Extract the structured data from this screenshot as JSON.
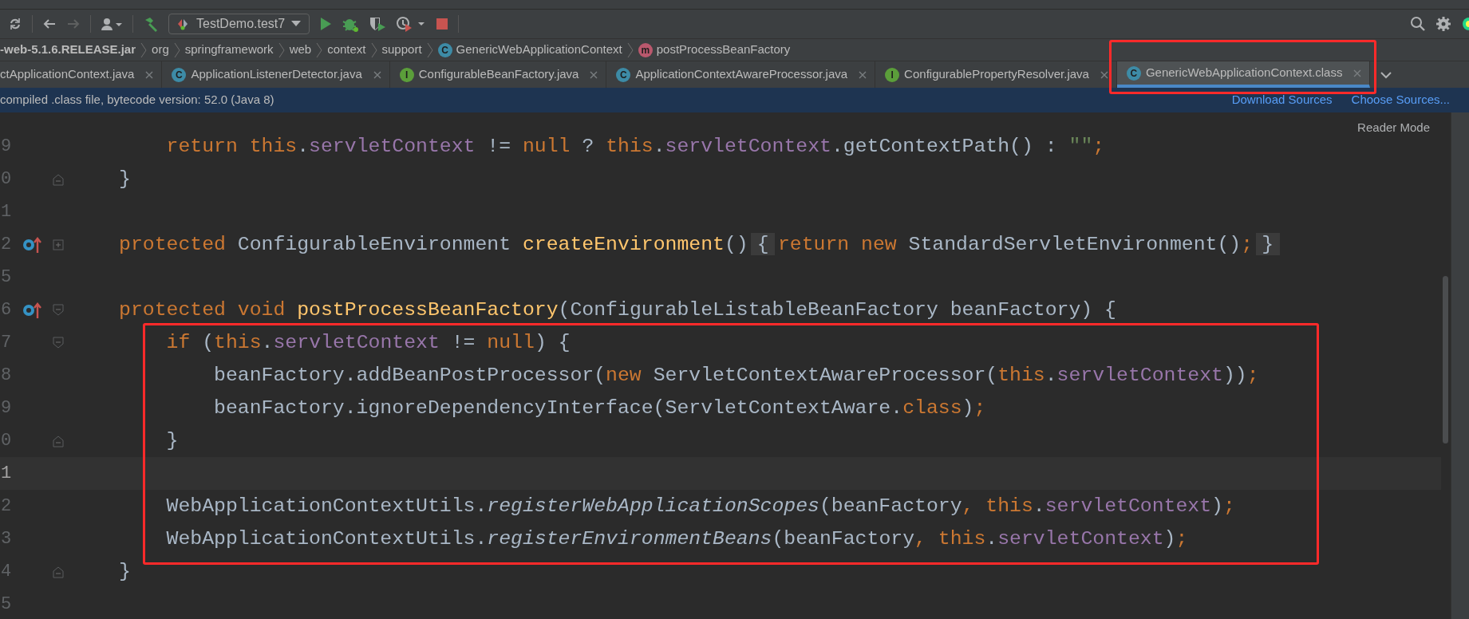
{
  "toolbar": {
    "run_config": "TestDemo.test7"
  },
  "breadcrumbs": [
    {
      "label": "-web-5.1.6.RELEASE.jar",
      "kind": "jar"
    },
    {
      "label": "org",
      "kind": "package"
    },
    {
      "label": "springframework",
      "kind": "package"
    },
    {
      "label": "web",
      "kind": "package"
    },
    {
      "label": "context",
      "kind": "package"
    },
    {
      "label": "support",
      "kind": "package"
    },
    {
      "label": "GenericWebApplicationContext",
      "kind": "class",
      "badge": "C"
    },
    {
      "label": "postProcessBeanFactory",
      "kind": "method",
      "badge": "m"
    }
  ],
  "tabs": [
    {
      "label": "ctApplicationContext.java",
      "kind": "plain",
      "selected": false,
      "highlighted": false
    },
    {
      "label": "ApplicationListenerDetector.java",
      "kind": "class",
      "badge": "C",
      "selected": false,
      "highlighted": false
    },
    {
      "label": "ConfigurableBeanFactory.java",
      "kind": "interface",
      "badge": "I",
      "selected": false,
      "highlighted": false
    },
    {
      "label": "ApplicationContextAwareProcessor.java",
      "kind": "class",
      "badge": "C",
      "selected": false,
      "highlighted": false
    },
    {
      "label": "ConfigurablePropertyResolver.java",
      "kind": "interface",
      "badge": "I",
      "selected": false,
      "highlighted": false
    },
    {
      "label": "GenericWebApplicationContext.class",
      "kind": "class",
      "badge": "C",
      "selected": true,
      "highlighted": true
    }
  ],
  "banner": {
    "message": "compiled .class file, bytecode version: 52.0 (Java 8)",
    "links": [
      "Download Sources",
      "Choose Sources..."
    ]
  },
  "editor": {
    "reader_mode": "Reader Mode",
    "lines": [
      {
        "number": "9",
        "kind": "plain",
        "override": false,
        "current": false,
        "tokens": [
          {
            "t": "    return ",
            "kind": "kw"
          },
          {
            "t": "this",
            "kind": "kw"
          },
          {
            "t": ".",
            "kind": "plain"
          },
          {
            "t": "servletContext",
            "kind": "field"
          },
          {
            "t": " != ",
            "kind": "plain"
          },
          {
            "t": "null",
            "kind": "kw"
          },
          {
            "t": " ? ",
            "kind": "plain"
          },
          {
            "t": "this",
            "kind": "kw"
          },
          {
            "t": ".",
            "kind": "plain"
          },
          {
            "t": "servletContext",
            "kind": "field"
          },
          {
            "t": ".getContextPath() : ",
            "kind": "plain"
          },
          {
            "t": "\"\"",
            "kind": "str"
          },
          {
            "t": ";",
            "kind": "kw"
          }
        ]
      },
      {
        "number": "0",
        "kind": "fold-end",
        "override": false,
        "current": false,
        "tokens": [
          {
            "t": "}",
            "kind": "plain"
          }
        ]
      },
      {
        "number": "1",
        "kind": "plain",
        "override": false,
        "current": false
      },
      {
        "number": "2",
        "kind": "folded",
        "override": true,
        "current": false,
        "tokens": [
          {
            "t": "protected ",
            "kind": "kw"
          },
          {
            "t": "ConfigurableEnvironment ",
            "kind": "plain"
          },
          {
            "t": "createEnvironment",
            "kind": "method"
          },
          {
            "t": "()",
            "kind": "plain"
          },
          {
            "t": "{",
            "kind": "fold"
          },
          {
            "t": "return new ",
            "kind": "kw"
          },
          {
            "t": "StandardServletEnvironment()",
            "kind": "plain"
          },
          {
            "t": ";",
            "kind": "kw"
          },
          {
            "t": "}",
            "kind": "fold"
          }
        ]
      },
      {
        "number": "5",
        "kind": "plain",
        "override": false,
        "current": false
      },
      {
        "number": "6",
        "kind": "fold-start",
        "override": true,
        "current": false,
        "tokens": [
          {
            "t": "protected void ",
            "kind": "kw"
          },
          {
            "t": "postProcessBeanFactory",
            "kind": "method"
          },
          {
            "t": "(ConfigurableListableBeanFactory beanFactory) {",
            "kind": "plain"
          }
        ]
      }
    ],
    "boxed_lines": [
      {
        "number": "7",
        "kind": "fold-start",
        "override": false,
        "current": false,
        "tokens": [
          {
            "t": "    if ",
            "kind": "kw"
          },
          {
            "t": "(",
            "kind": "plain"
          },
          {
            "t": "this",
            "kind": "kw"
          },
          {
            "t": ".",
            "kind": "plain"
          },
          {
            "t": "servletContext",
            "kind": "field"
          },
          {
            "t": " != ",
            "kind": "plain"
          },
          {
            "t": "null",
            "kind": "kw"
          },
          {
            "t": ") {",
            "kind": "plain"
          }
        ]
      },
      {
        "number": "8",
        "kind": "plain",
        "override": false,
        "current": false,
        "tokens": [
          {
            "t": "        beanFactory.addBeanPostProcessor(",
            "kind": "plain"
          },
          {
            "t": "new ",
            "kind": "kw"
          },
          {
            "t": "ServletContextAwareProcessor(",
            "kind": "plain"
          },
          {
            "t": "this",
            "kind": "kw"
          },
          {
            "t": ".",
            "kind": "plain"
          },
          {
            "t": "servletContext",
            "kind": "field"
          },
          {
            "t": "))",
            "kind": "plain"
          },
          {
            "t": ";",
            "kind": "kw"
          }
        ]
      },
      {
        "number": "9",
        "kind": "plain",
        "override": false,
        "current": false,
        "tokens": [
          {
            "t": "        beanFactory.ignoreDependencyInterface(ServletContextAware.",
            "kind": "plain"
          },
          {
            "t": "class",
            "kind": "kw"
          },
          {
            "t": ")",
            "kind": "plain"
          },
          {
            "t": ";",
            "kind": "kw"
          }
        ]
      },
      {
        "number": "0",
        "kind": "fold-end",
        "override": false,
        "current": false,
        "tokens": [
          {
            "t": "    }",
            "kind": "plain"
          }
        ]
      },
      {
        "number": "1",
        "kind": "plain",
        "override": false,
        "current": true
      },
      {
        "number": "2",
        "kind": "plain",
        "override": false,
        "current": false,
        "tokens": [
          {
            "t": "    WebApplicationContextUtils.",
            "kind": "plain"
          },
          {
            "t": "registerWebApplicationScopes",
            "kind": "static"
          },
          {
            "t": "(beanFactory",
            "kind": "plain"
          },
          {
            "t": ", ",
            "kind": "kw"
          },
          {
            "t": "this",
            "kind": "kw"
          },
          {
            "t": ".",
            "kind": "plain"
          },
          {
            "t": "servletContext",
            "kind": "field"
          },
          {
            "t": ")",
            "kind": "plain"
          },
          {
            "t": ";",
            "kind": "kw"
          }
        ]
      },
      {
        "number": "3",
        "kind": "plain",
        "override": false,
        "current": false,
        "tokens": [
          {
            "t": "    WebApplicationContextUtils.",
            "kind": "plain"
          },
          {
            "t": "registerEnvironmentBeans",
            "kind": "static"
          },
          {
            "t": "(beanFactory",
            "kind": "plain"
          },
          {
            "t": ", ",
            "kind": "kw"
          },
          {
            "t": "this",
            "kind": "kw"
          },
          {
            "t": ".",
            "kind": "plain"
          },
          {
            "t": "servletContext",
            "kind": "field"
          },
          {
            "t": ")",
            "kind": "plain"
          },
          {
            "t": ";",
            "kind": "kw"
          }
        ]
      }
    ],
    "lines_after": [
      {
        "number": "4",
        "kind": "fold-end",
        "override": false,
        "current": false,
        "tokens": [
          {
            "t": "}",
            "kind": "plain"
          }
        ]
      },
      {
        "number": "5",
        "kind": "plain",
        "override": false,
        "current": false
      }
    ]
  }
}
